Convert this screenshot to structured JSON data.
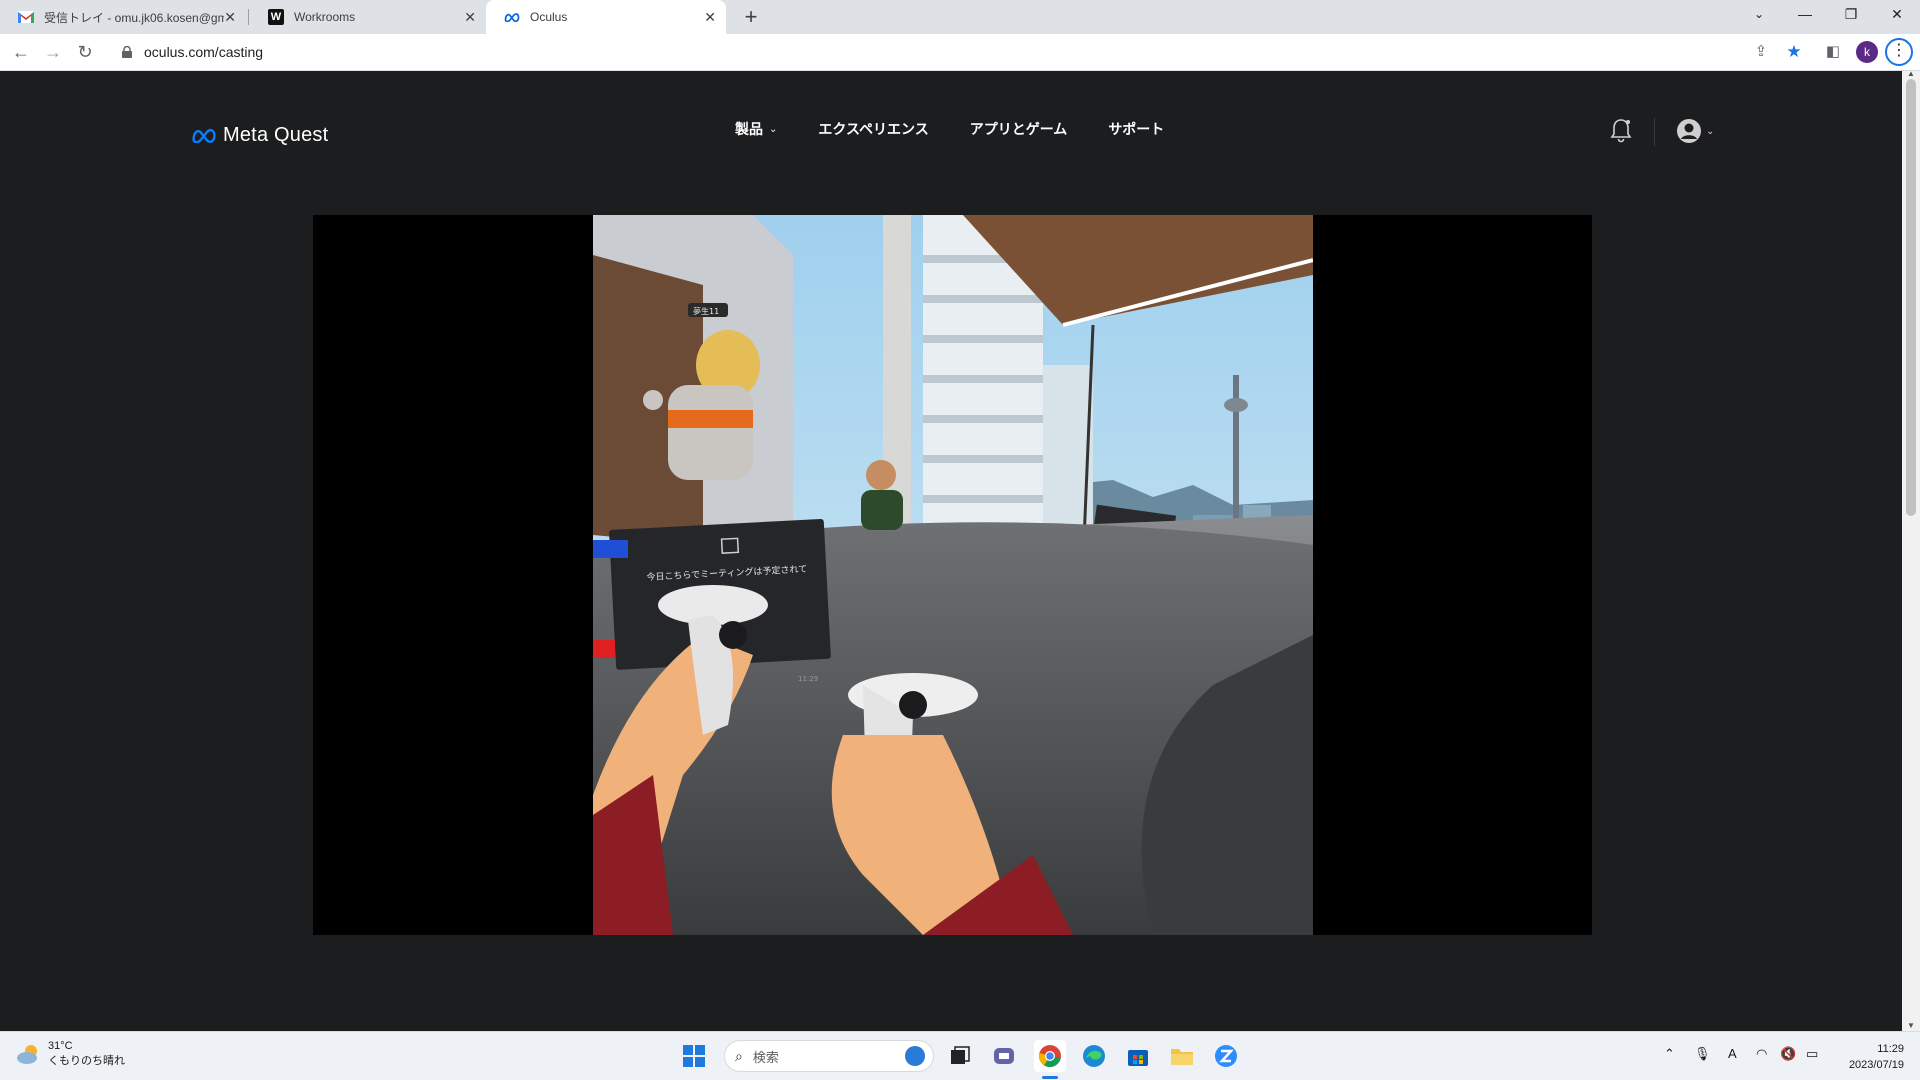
{
  "browser": {
    "tabs": [
      {
        "title": "受信トレイ - omu.jk06.kosen@gm",
        "icon": "gmail-icon",
        "active": false
      },
      {
        "title": "Workrooms",
        "icon": "workrooms-icon",
        "active": false
      },
      {
        "title": "Oculus",
        "icon": "meta-icon",
        "active": true
      }
    ],
    "url": "oculus.com/casting",
    "profile_initial": "k"
  },
  "page": {
    "logo_text": "Meta Quest",
    "nav": [
      {
        "label": "製品",
        "has_dropdown": true
      },
      {
        "label": "エクスペリエンス",
        "has_dropdown": false
      },
      {
        "label": "アプリとゲーム",
        "has_dropdown": false
      },
      {
        "label": "サポート",
        "has_dropdown": false
      }
    ],
    "cast_view": {
      "avatar_tag": "夢生11",
      "notice": "今日こちらでミーティングは予定されて",
      "controller_time": "11:29"
    }
  },
  "taskbar": {
    "weather_temp": "31°C",
    "weather_desc": "くもりのち晴れ",
    "search_placeholder": "検索",
    "time": "11:29",
    "date": "2023/07/19"
  },
  "colors": {
    "page_bg": "#1c1d1f",
    "tabstrip": "#dee1e6",
    "meta_blue": "#0668e1",
    "taskbar": "#eef1f5"
  }
}
